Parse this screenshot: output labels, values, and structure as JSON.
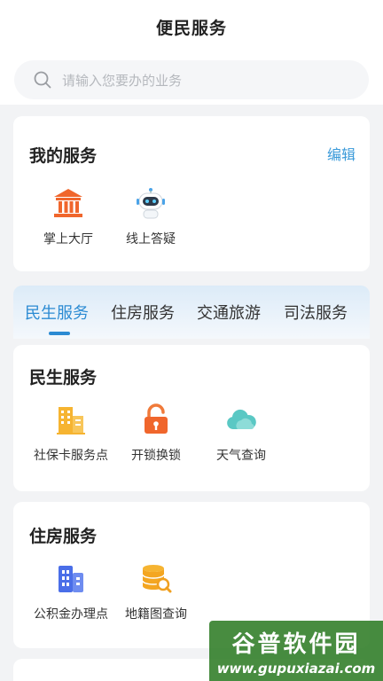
{
  "header": {
    "title": "便民服务"
  },
  "search": {
    "placeholder": "请输入您要办的业务"
  },
  "my_services": {
    "title": "我的服务",
    "edit_label": "编辑",
    "items": [
      {
        "label": "掌上大厅",
        "icon": "government-hall-icon"
      },
      {
        "label": "线上答疑",
        "icon": "robot-assistant-icon"
      }
    ]
  },
  "tabs": [
    {
      "label": "民生服务",
      "active": true
    },
    {
      "label": "住房服务",
      "active": false
    },
    {
      "label": "交通旅游",
      "active": false
    },
    {
      "label": "司法服务",
      "active": false
    }
  ],
  "livelihood": {
    "title": "民生服务",
    "items": [
      {
        "label": "社保卡服务点",
        "icon": "building-icon"
      },
      {
        "label": "开锁换锁",
        "icon": "unlock-icon"
      },
      {
        "label": "天气查询",
        "icon": "cloud-icon"
      }
    ]
  },
  "housing": {
    "title": "住房服务",
    "items": [
      {
        "label": "公积金办理点",
        "icon": "office-building-icon"
      },
      {
        "label": "地籍图查询",
        "icon": "database-search-icon"
      }
    ]
  },
  "watermark": {
    "line1": "谷普软件园",
    "line2": "www.gupuxiazai.com"
  },
  "colors": {
    "accent": "#2c8bd3",
    "edit": "#3a9ad9",
    "background": "#f2f3f5"
  }
}
